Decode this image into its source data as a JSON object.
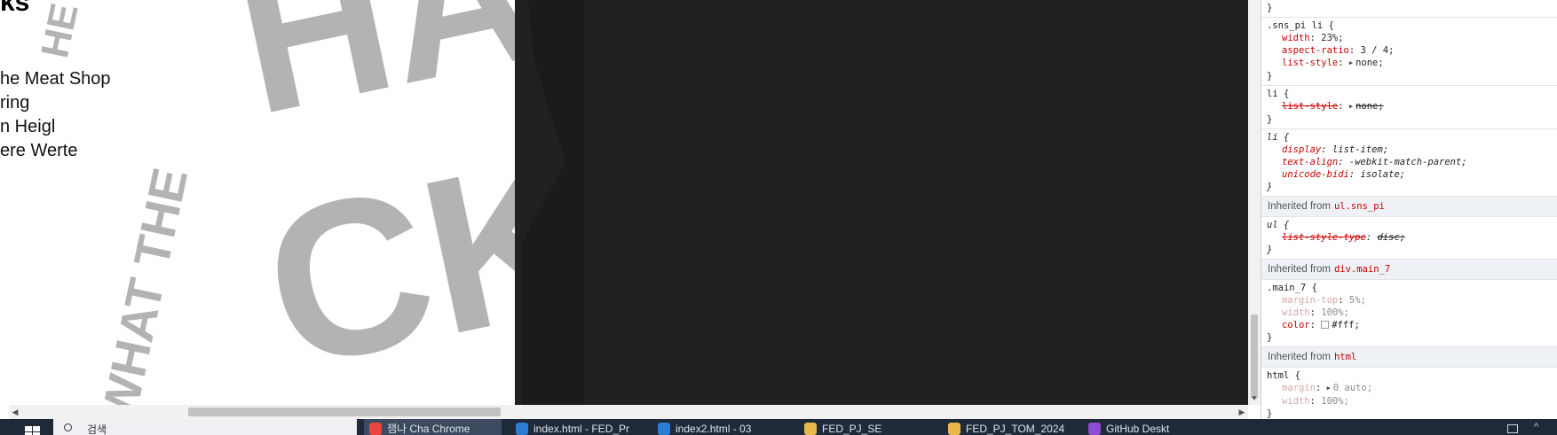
{
  "page": {
    "heading": "ks",
    "nav_items": [
      "he Meat Shop",
      "ring",
      "n Heigl",
      "ere Werte"
    ],
    "poster_letters": [
      "HA",
      "CK",
      "WHAT THE",
      "HE"
    ]
  },
  "devtools": {
    "rules": [
      {
        "selector": "}",
        "origin": "author",
        "decls": []
      },
      {
        "selector": ".sns_pi li {",
        "origin": "author",
        "decls": [
          {
            "prop": "width",
            "value": "23%;",
            "state": "normal"
          },
          {
            "prop": "aspect-ratio",
            "value": "3 / 4;",
            "state": "normal"
          },
          {
            "prop": "list-style",
            "value": "none;",
            "state": "normal",
            "expand": true
          }
        ]
      },
      {
        "selector": "li {",
        "origin": "author",
        "decls": [
          {
            "prop": "list-style",
            "value": "none;",
            "state": "overridden",
            "expand": true
          }
        ]
      },
      {
        "selector": "li {",
        "origin": "ua",
        "decls": [
          {
            "prop": "display",
            "value": "list-item;",
            "state": "normal"
          },
          {
            "prop": "text-align",
            "value": "-webkit-match-parent;",
            "state": "normal"
          },
          {
            "prop": "unicode-bidi",
            "value": "isolate;",
            "state": "normal"
          }
        ]
      }
    ],
    "inherited": [
      {
        "label": "Inherited from",
        "source": "ul.sns_pi",
        "rules": [
          {
            "selector": "ul {",
            "origin": "ua",
            "decls": [
              {
                "prop": "list-style-type",
                "value": "disc;",
                "state": "overridden"
              }
            ]
          }
        ]
      },
      {
        "label": "Inherited from",
        "source": "div.main_7",
        "rules": [
          {
            "selector": ".main_7 {",
            "origin": "author",
            "decls": [
              {
                "prop": "margin-top",
                "value": "5%;",
                "state": "faded"
              },
              {
                "prop": "width",
                "value": "100%;",
                "state": "faded"
              },
              {
                "prop": "color",
                "value": "#fff;",
                "state": "normal",
                "swatch": "#ffffff"
              }
            ]
          }
        ]
      },
      {
        "label": "Inherited from",
        "source": "html",
        "rules": [
          {
            "selector": "html {",
            "origin": "author",
            "decls": [
              {
                "prop": "margin",
                "value": "0 auto;",
                "state": "faded",
                "expand": true
              },
              {
                "prop": "width",
                "value": "100%;",
                "state": "faded"
              }
            ]
          }
        ]
      }
    ]
  },
  "taskbar": {
    "search_text": "검색",
    "tasks": [
      {
        "label": "잼나 Cha Chrome",
        "icon_color": "#e8453c",
        "active": true
      },
      {
        "label": "index.html - FED_Pr",
        "icon_color": "#2b7cd3",
        "active": false
      },
      {
        "label": "index2.html - 03",
        "icon_color": "#2b7cd3",
        "active": false
      },
      {
        "label": "FED_PJ_SE",
        "icon_color": "#e8b84a",
        "active": false
      },
      {
        "label": "FED_PJ_TOM_2024",
        "icon_color": "#e8b84a",
        "active": false
      },
      {
        "label": "GitHub Deskt",
        "icon_color": "#8e4bd6",
        "active": false
      }
    ]
  },
  "colors": {
    "dark_pane": "#212121",
    "poster_gray": "#b3b3b3",
    "css_property": "#c80000",
    "taskbar": "#1e2a3a"
  }
}
